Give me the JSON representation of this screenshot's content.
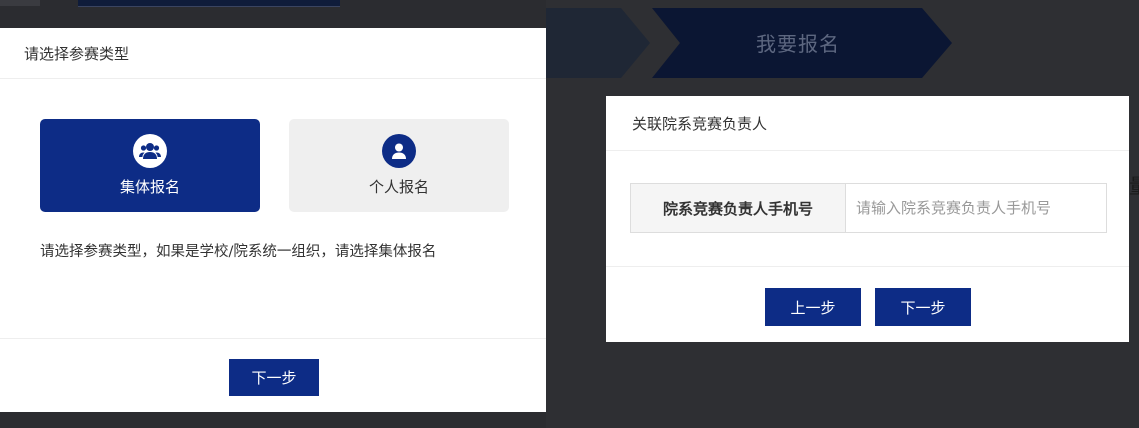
{
  "screen1": {
    "dialog_title": "请选择参赛类型",
    "options": [
      {
        "label": "集体报名",
        "icon": "group-icon",
        "selected": true
      },
      {
        "label": "个人报名",
        "icon": "user-icon",
        "selected": false
      }
    ],
    "hint": "请选择参赛类型，如果是学校/院系统一组织，请选择集体报名",
    "next_button": "下一步"
  },
  "screen2": {
    "step_title": "我要报名",
    "edge_text": "量",
    "dialog_title": "关联院系竞赛负责人",
    "phone_label": "院系竞赛负责人手机号",
    "phone_placeholder": "请输入院系竞赛负责人手机号",
    "phone_value": "",
    "prev_button": "上一步",
    "next_button": "下一步"
  },
  "colors": {
    "primary": "#0d2c86",
    "overlay": "#2b2c30",
    "card_inactive": "#efefef"
  }
}
